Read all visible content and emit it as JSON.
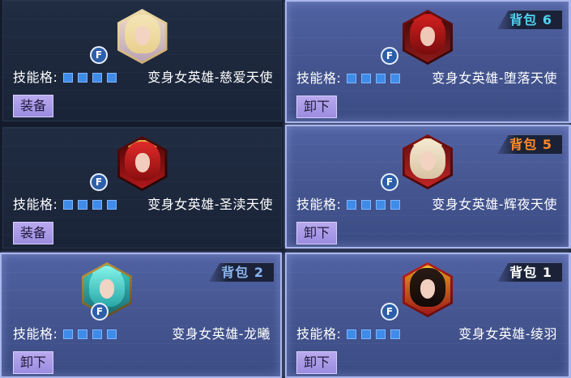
{
  "skill_label": "技能格:",
  "colors": {
    "bag_cyan": "#4fd1f0",
    "bag_orange": "#ff8a2a",
    "bag_blue": "#8ab4f0",
    "bag_white": "#ffffff",
    "slot_blue": "#3f8ce8"
  },
  "cards": [
    {
      "hero_name": "变身女英雄-慈爱天使",
      "button_label": "装备",
      "bag_label": "",
      "selected": false,
      "skill_slots": 4,
      "portrait": "blonde-angel-portrait"
    },
    {
      "hero_name": "变身女英雄-堕落天使",
      "button_label": "卸下",
      "bag_label": "背包 6",
      "selected": true,
      "skill_slots": 4,
      "portrait": "red-hair-fallen-angel-portrait"
    },
    {
      "hero_name": "变身女英雄-圣渎天使",
      "button_label": "装备",
      "bag_label": "",
      "selected": false,
      "skill_slots": 4,
      "portrait": "red-dark-angel-portrait"
    },
    {
      "hero_name": "变身女英雄-辉夜天使",
      "button_label": "卸下",
      "bag_label": "背包 5",
      "selected": true,
      "skill_slots": 4,
      "portrait": "light-hair-night-angel-portrait"
    },
    {
      "hero_name": "变身女英雄-龙曦",
      "button_label": "卸下",
      "bag_label": "背包 2",
      "selected": true,
      "skill_slots": 4,
      "portrait": "teal-hair-dragon-portrait"
    },
    {
      "hero_name": "变身女英雄-绫羽",
      "button_label": "卸下",
      "bag_label": "背包 1",
      "selected": true,
      "skill_slots": 4,
      "portrait": "black-hair-phoenix-portrait"
    }
  ]
}
